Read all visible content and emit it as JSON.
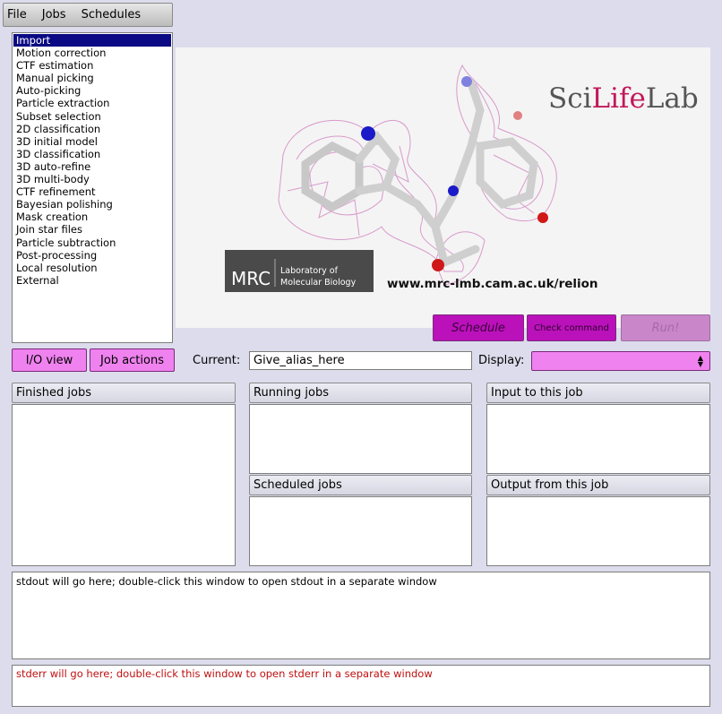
{
  "menu": [
    "File",
    "Jobs",
    "Schedules"
  ],
  "job_types": [
    "Import",
    "Motion correction",
    "CTF estimation",
    "Manual picking",
    "Auto-picking",
    "Particle extraction",
    "Subset selection",
    "2D classification",
    "3D initial model",
    "3D classification",
    "3D auto-refine",
    "3D multi-body",
    "CTF refinement",
    "Bayesian polishing",
    "Mask creation",
    "Join star files",
    "Particle subtraction",
    "Post-processing",
    "Local resolution",
    "External"
  ],
  "selected_job_type": "Import",
  "banner": {
    "scilifelab": {
      "sci": "Sci",
      "life": "Life",
      "lab": "Lab"
    },
    "mrc_logo": "MRC",
    "mrc_line1": "Laboratory of",
    "mrc_line2": "Molecular Biology",
    "url": "www.mrc-lmb.cam.ac.uk/relion"
  },
  "actions": {
    "schedule": "Schedule",
    "check_command": "Check command",
    "run": "Run!"
  },
  "view": {
    "io_view": "I/O view",
    "job_actions": "Job actions",
    "current_label": "Current:",
    "current_value": "Give_alias_here",
    "display_label": "Display:",
    "display_value": ""
  },
  "panels": {
    "finished": "Finished jobs",
    "running": "Running jobs",
    "scheduled": "Scheduled jobs",
    "input": "Input to this job",
    "output": "Output from this job"
  },
  "logs": {
    "stdout": "stdout will go here; double-click this window to open stdout in a separate window",
    "stderr": "stderr will go here; double-click this window to open stderr in a separate window"
  },
  "colors": {
    "accent": "#bb11bb",
    "button_pink": "#ef82ef",
    "selection": "#0b0a84",
    "scilifelab_pink": "#c2185b",
    "mrc_gray": "#4a4a4a"
  }
}
